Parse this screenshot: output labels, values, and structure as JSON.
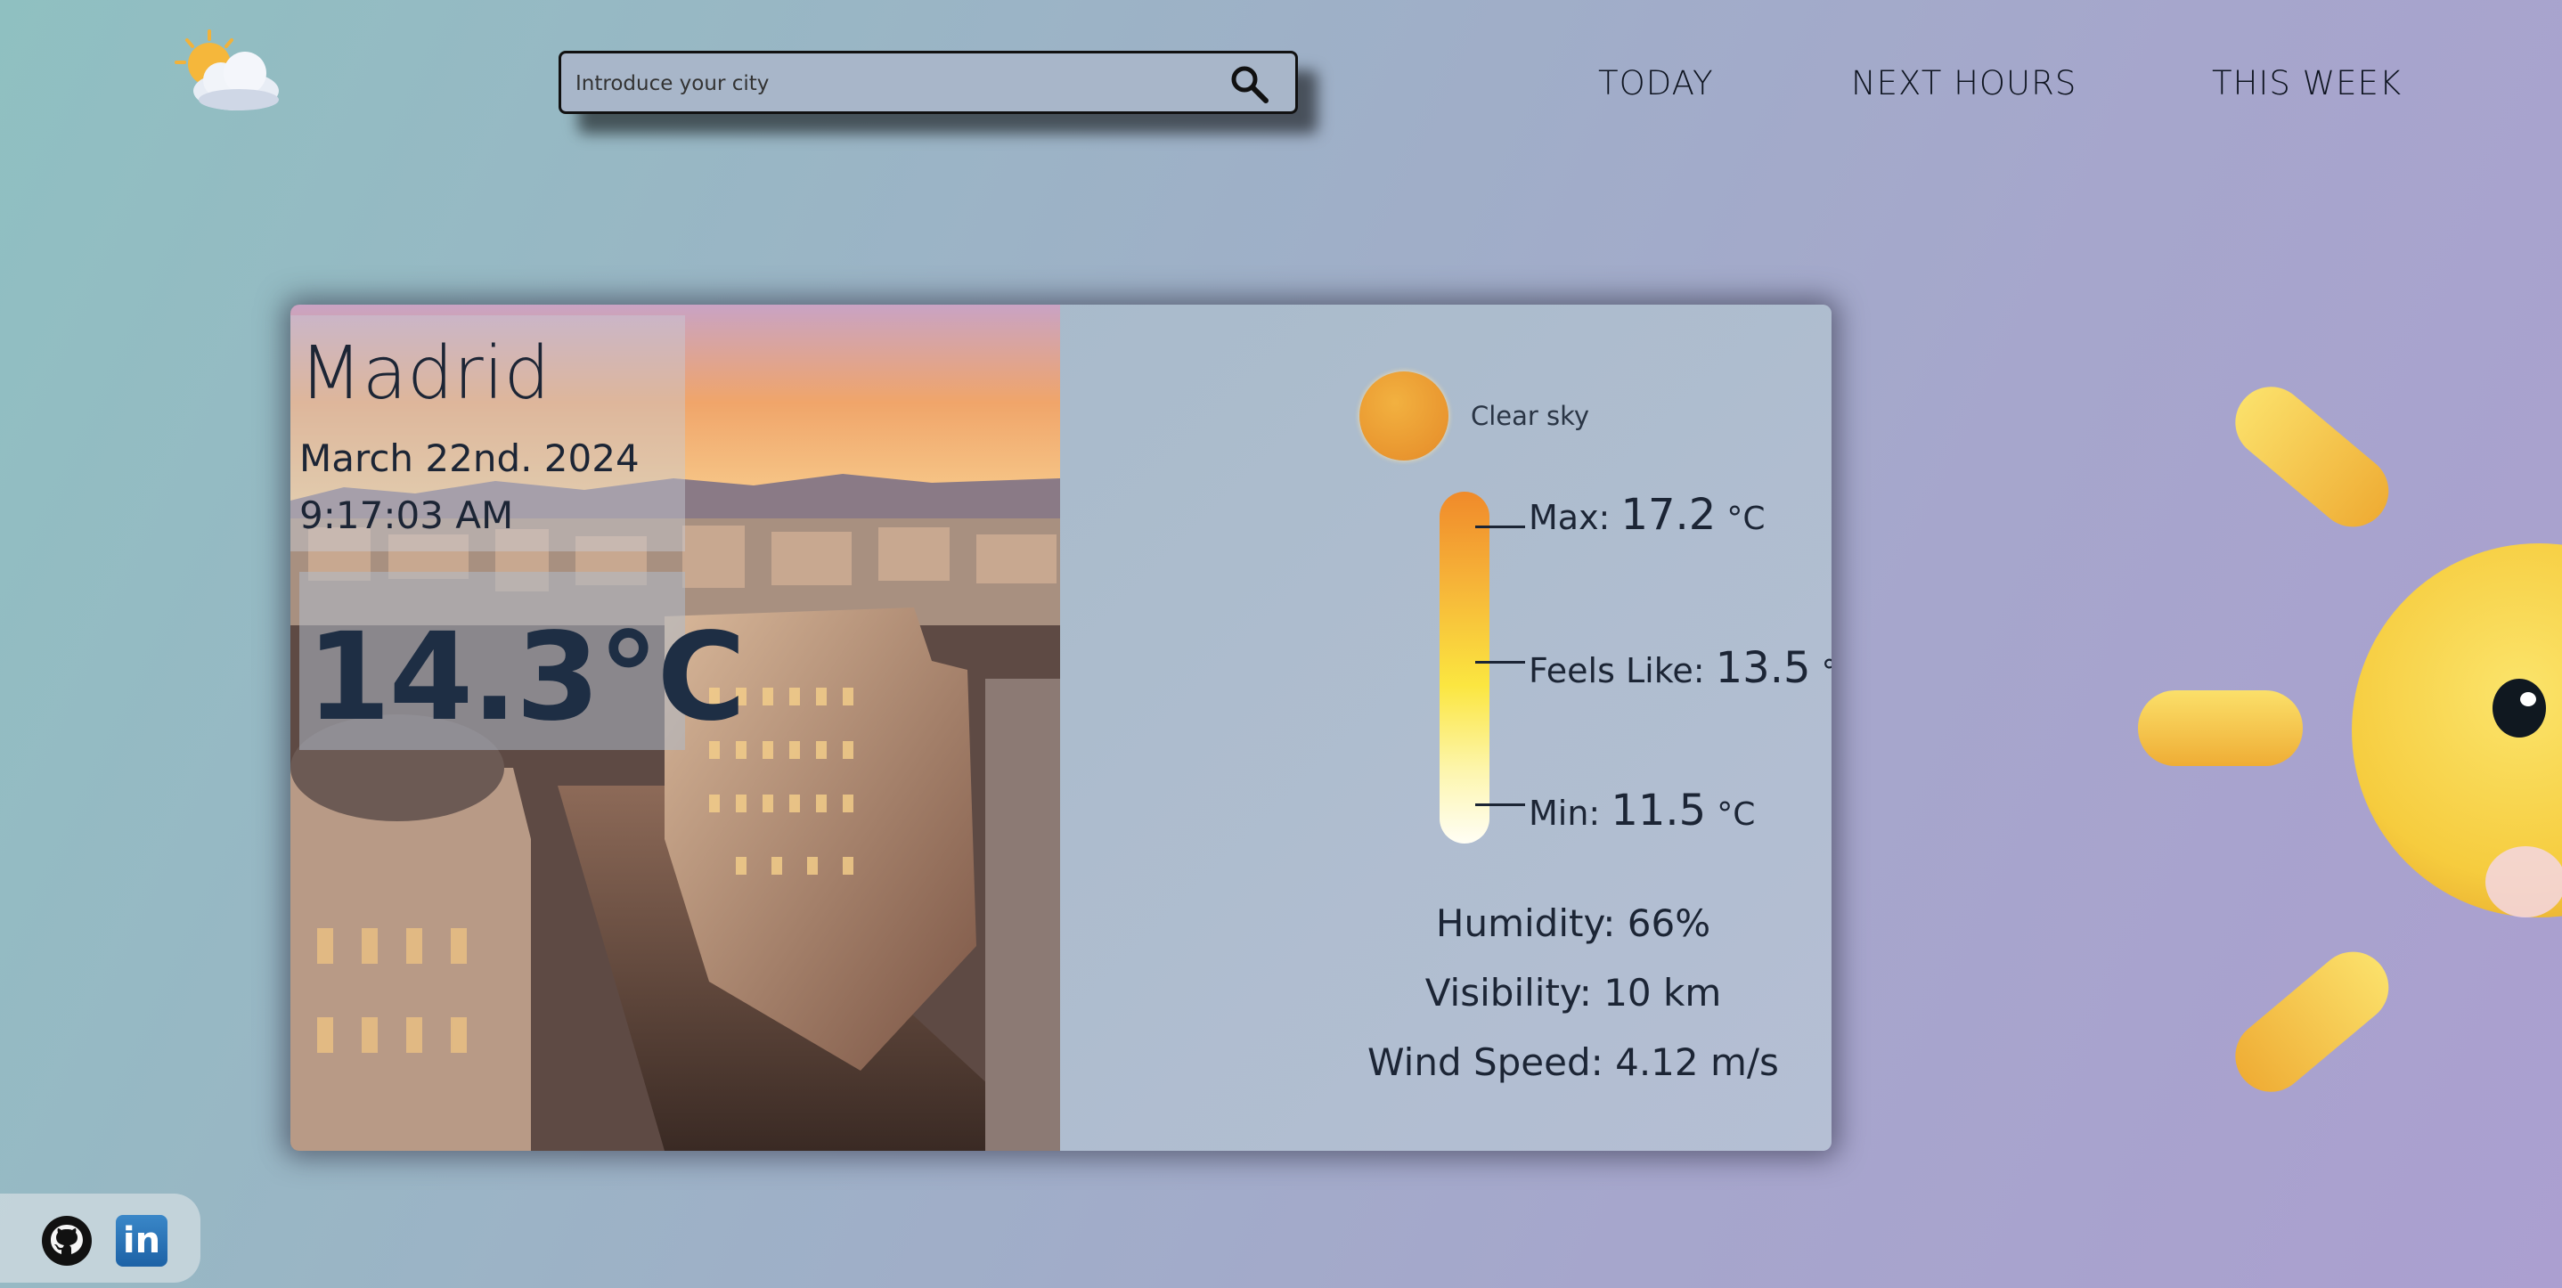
{
  "header": {
    "search_placeholder": "Introduce your city",
    "nav": [
      {
        "label": "TODAY"
      },
      {
        "label": "NEXT HOURS"
      },
      {
        "label": "THIS WEEK"
      }
    ]
  },
  "weather": {
    "city": "Madrid",
    "date": "March 22nd. 2024",
    "time": "9:17:03 AM",
    "temperature": "14.3°C",
    "condition": "Clear sky",
    "max_label": "Max: ",
    "max_value": "17.2",
    "feels_label": "Feels Like: ",
    "feels_value": "13.5",
    "min_label": "Min: ",
    "min_value": "11.5",
    "unit": "°C",
    "humidity": "Humidity: 66%",
    "visibility": "Visibility: 10 km",
    "wind": "Wind Speed: 4.12 m/s"
  },
  "social": {
    "linkedin_text": "in"
  },
  "icons": [
    "weather-logo-icon",
    "search-icon",
    "sun-icon",
    "github-icon",
    "linkedin-icon"
  ],
  "colors": {
    "background_start": "#8fc0c1",
    "background_end": "#ab9fd0",
    "text_dark": "#1c2535",
    "thermo_top": "#f08a2a",
    "thermo_bottom": "#fffef5",
    "sun_yellow": "#f7d640"
  }
}
